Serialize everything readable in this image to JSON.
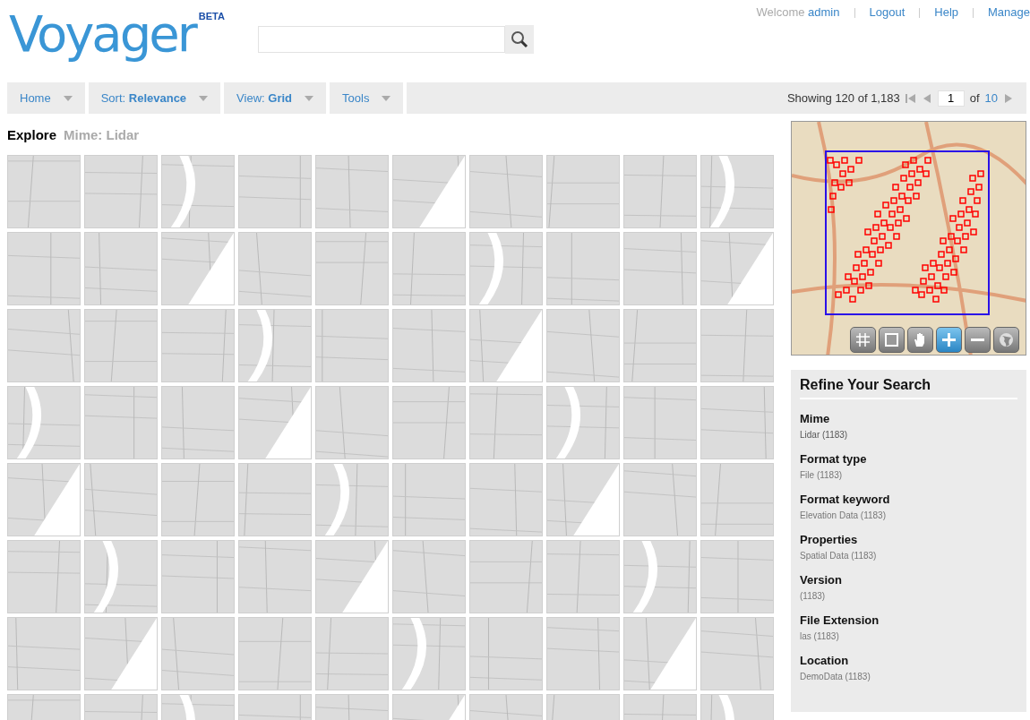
{
  "logo": {
    "text": "Voyager",
    "badge": "BETA"
  },
  "user_links": {
    "welcome": "Welcome",
    "user": "admin",
    "links": [
      "Logout",
      "Help",
      "Manage"
    ]
  },
  "toolbar": {
    "menus": [
      {
        "label": "Home"
      },
      {
        "label": "Sort:",
        "value": "Relevance"
      },
      {
        "label": "View:",
        "value": "Grid"
      },
      {
        "label": "Tools"
      }
    ],
    "showing": "Showing 120 of 1,183",
    "page": "1",
    "of": "of",
    "total_pages": "10"
  },
  "breadcrumb": {
    "title": "Explore",
    "filter": "Mime: Lidar"
  },
  "map_tools": [
    {
      "kind": "grid",
      "selected": false
    },
    {
      "kind": "box",
      "selected": false
    },
    {
      "kind": "pan",
      "selected": false
    },
    {
      "kind": "zoom-in",
      "selected": true
    },
    {
      "kind": "zoom-out",
      "selected": false
    },
    {
      "kind": "globe",
      "selected": false
    }
  ],
  "refine": {
    "title": "Refine Your Search",
    "facets": [
      {
        "name": "Mime",
        "value": "Lidar (1183)",
        "strong": true
      },
      {
        "name": "Format type",
        "value": "File (1183)",
        "strong": false
      },
      {
        "name": "Format keyword",
        "value": "Elevation Data (1183)",
        "strong": false
      },
      {
        "name": "Properties",
        "value": "Spatial Data (1183)",
        "strong": false
      },
      {
        "name": "Version",
        "value": "(1183)",
        "strong": false
      },
      {
        "name": "File Extension",
        "value": "las (1183)",
        "strong": false
      },
      {
        "name": "Location",
        "value": "DemoData (1183)",
        "strong": false
      }
    ]
  }
}
